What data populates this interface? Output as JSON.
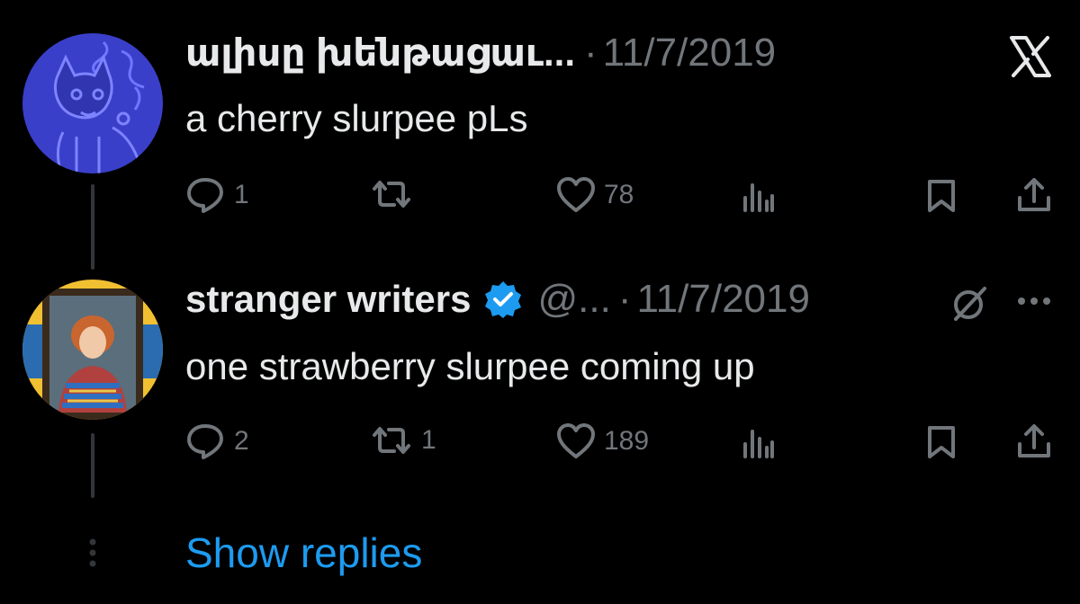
{
  "tweets": [
    {
      "author": "ալիսը խենթացաւ...",
      "separator": "·",
      "date": "11/7/2019",
      "text": "a cherry slurpee pLs",
      "replies": "1",
      "retweets": "",
      "likes": "78",
      "avatar_icon": "cartoon-cat-avatar"
    },
    {
      "author": "stranger writers",
      "verified": true,
      "handle": "@...",
      "separator": "·",
      "date": "11/7/2019",
      "text": "one strawberry slurpee coming up",
      "replies": "2",
      "retweets": "1",
      "likes": "189",
      "avatar_icon": "portrait-avatar"
    }
  ],
  "close_icon": "x-logo-icon",
  "more_icon": "ellipsis-icon",
  "grok_icon": "slash-circle-icon",
  "show_replies": "Show replies",
  "colors": {
    "background": "#000000",
    "text": "#e7e9ea",
    "muted": "#71767b",
    "accent": "#1d9bf0"
  }
}
